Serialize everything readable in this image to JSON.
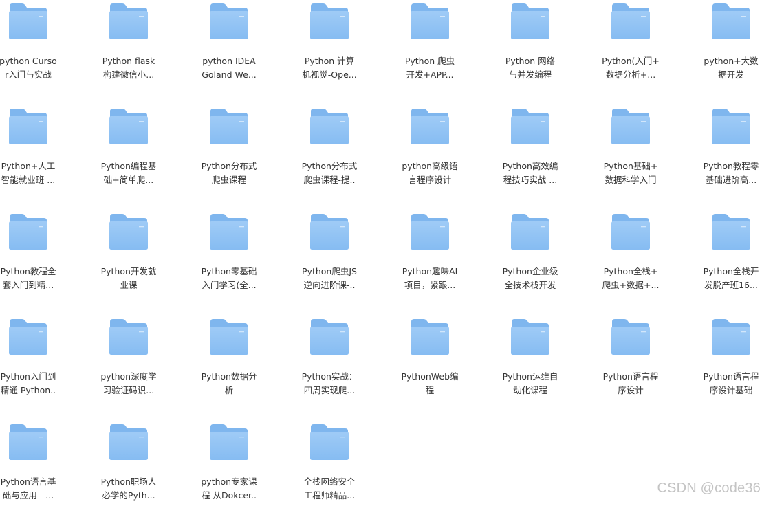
{
  "folders": [
    {
      "label": "python Curso\nr入门与实战"
    },
    {
      "label": "Python flask\n构建微信小..."
    },
    {
      "label": "python IDEA\nGoland We..."
    },
    {
      "label": "Python 计算\n机视觉-Ope..."
    },
    {
      "label": "Python 爬虫\n开发+APP..."
    },
    {
      "label": "Python 网络\n与并发编程"
    },
    {
      "label": "Python(入门+\n数据分析+..."
    },
    {
      "label": "python+大数\n据开发"
    },
    {
      "label": "Python+人工\n智能就业班 ..."
    },
    {
      "label": "Python编程基\n础+简单爬..."
    },
    {
      "label": "Python分布式\n爬虫课程"
    },
    {
      "label": "Python分布式\n爬虫课程-提.."
    },
    {
      "label": "python高级语\n言程序设计"
    },
    {
      "label": "Python高效编\n程技巧实战 ..."
    },
    {
      "label": "Python基础+\n数据科学入门"
    },
    {
      "label": "Python教程零\n基础进阶高..."
    },
    {
      "label": "Python教程全\n套入门到精..."
    },
    {
      "label": "Python开发就\n业课"
    },
    {
      "label": "Python零基础\n入门学习(全..."
    },
    {
      "label": "Python爬虫JS\n逆向进阶课-.."
    },
    {
      "label": "Python趣味AI\n项目，紧跟..."
    },
    {
      "label": "Python企业级\n全技术栈开发"
    },
    {
      "label": "Python全栈+\n爬虫+数据+..."
    },
    {
      "label": "Python全栈开\n发脱产班16..."
    },
    {
      "label": "Python入门到\n精通 Python.."
    },
    {
      "label": "python深度学\n习验证码识..."
    },
    {
      "label": "Python数据分\n析"
    },
    {
      "label": "Python实战：\n四周实现爬..."
    },
    {
      "label": "PythonWeb编\n程"
    },
    {
      "label": "Python运维自\n动化课程"
    },
    {
      "label": "Python语言程\n序设计"
    },
    {
      "label": "Python语言程\n序设计基础"
    },
    {
      "label": "Python语言基\n础与应用 - ..."
    },
    {
      "label": "Python职场人\n必学的Pyth..."
    },
    {
      "label": "python专家课\n程 从Dokcer.."
    },
    {
      "label": "全栈网络安全\n工程师精品..."
    }
  ],
  "watermark": "CSDN @code36",
  "colors": {
    "folder_back": "#7fb6ee",
    "folder_front_top": "#9fcbf6",
    "folder_front_bottom": "#86bcf2",
    "text": "#333333",
    "watermark": "#c4c4c4"
  },
  "icon": "folder-icon"
}
